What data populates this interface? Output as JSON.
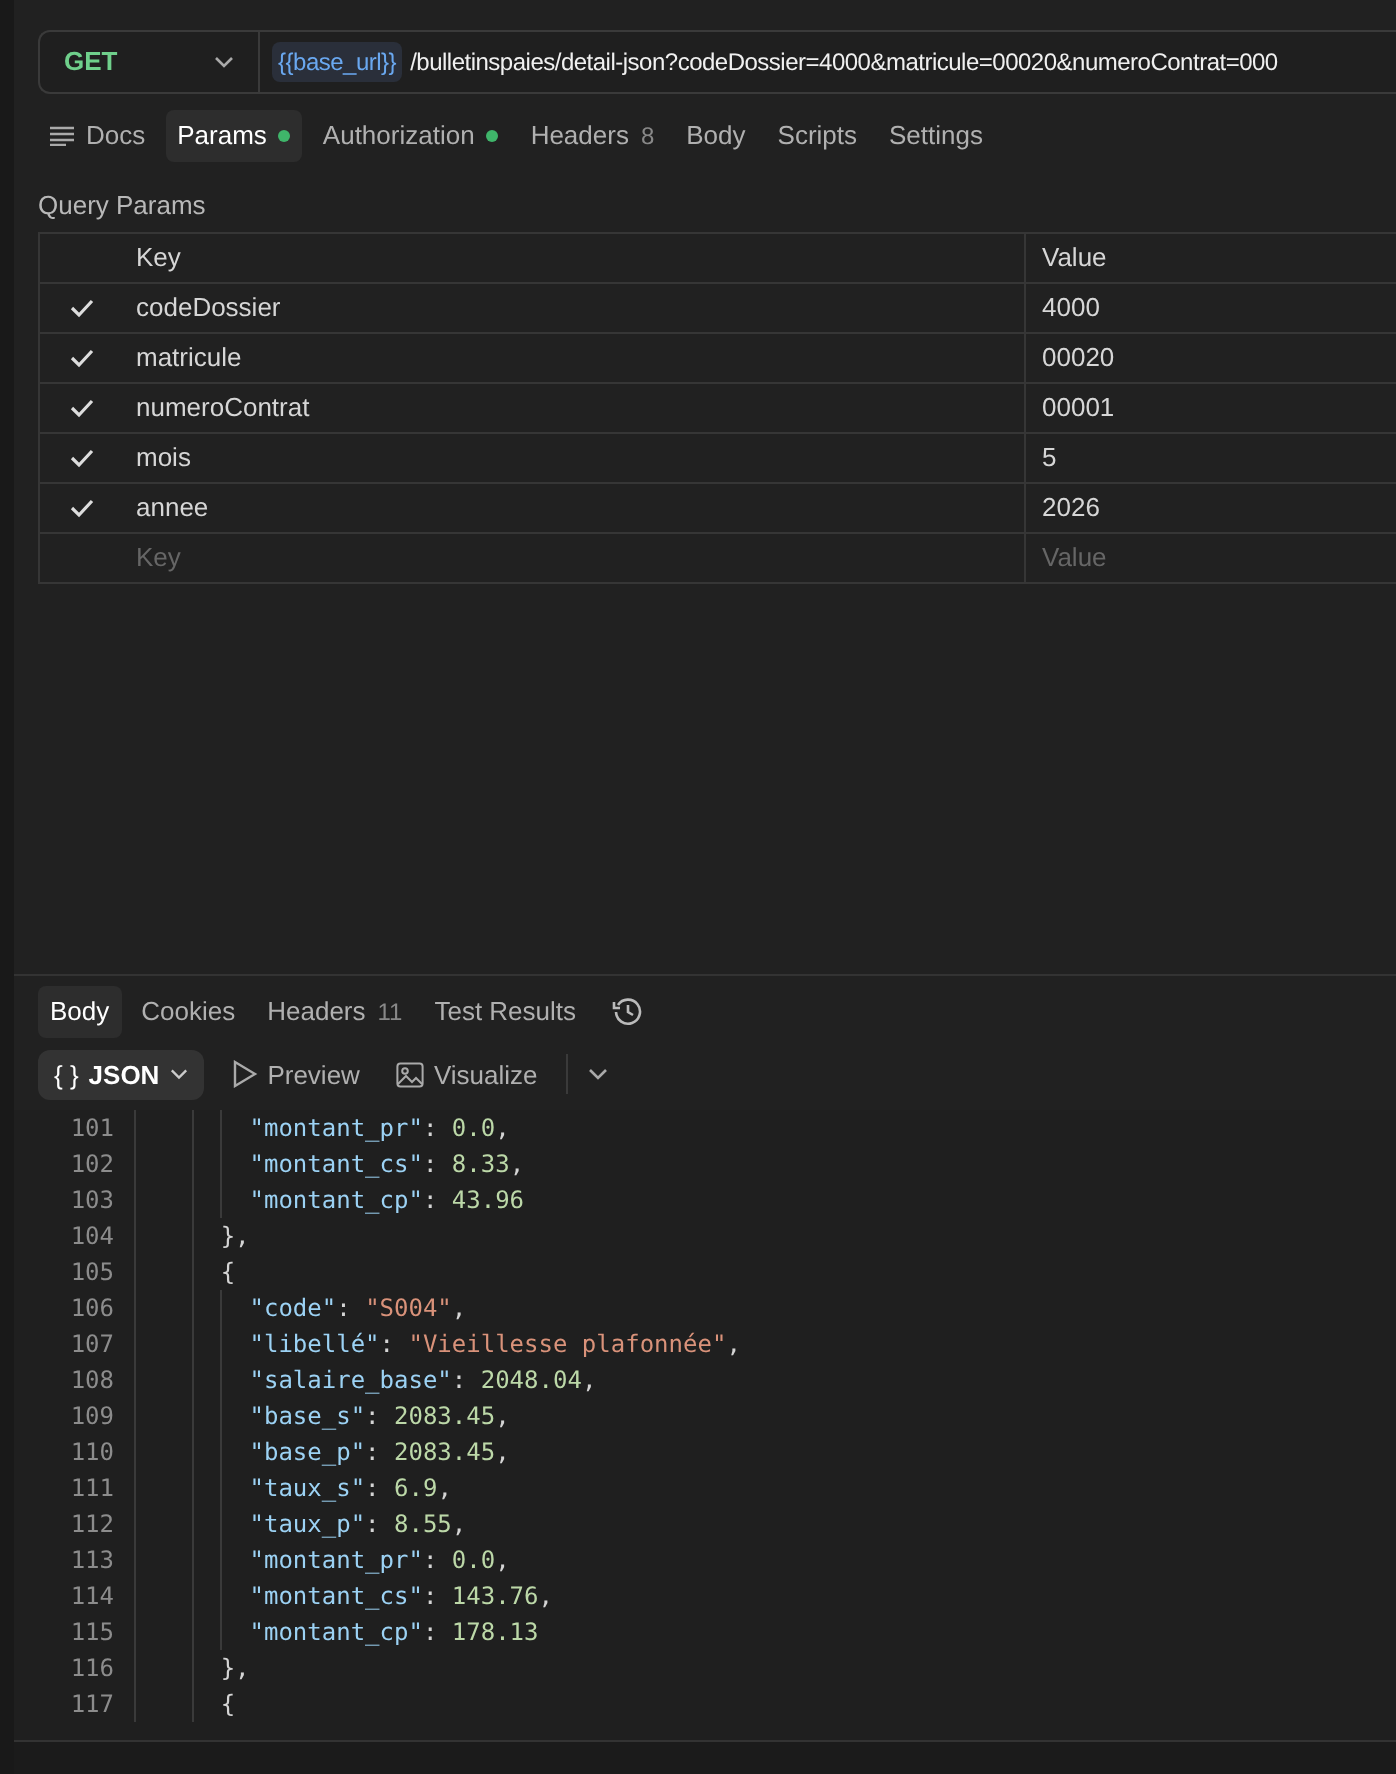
{
  "request": {
    "method": "GET",
    "url_variable": "{{base_url}}",
    "url_path": "/bulletinspaies/detail-json?codeDossier=4000&matricule=00020&numeroContrat=000"
  },
  "request_tabs": [
    {
      "label": "Docs",
      "kind": "docs",
      "selected": false
    },
    {
      "label": "Params",
      "kind": "dot",
      "selected": true
    },
    {
      "label": "Authorization",
      "kind": "dot",
      "selected": false
    },
    {
      "label": "Headers",
      "count": "8",
      "kind": "count",
      "selected": false
    },
    {
      "label": "Body",
      "kind": "plain",
      "selected": false
    },
    {
      "label": "Scripts",
      "kind": "plain",
      "selected": false
    },
    {
      "label": "Settings",
      "kind": "plain",
      "selected": false
    }
  ],
  "query_params": {
    "title": "Query Params",
    "columns": [
      "Key",
      "Value"
    ],
    "rows": [
      {
        "checked": true,
        "key": "codeDossier",
        "value": "4000"
      },
      {
        "checked": true,
        "key": "matricule",
        "value": "00020"
      },
      {
        "checked": true,
        "key": "numeroContrat",
        "value": "00001"
      },
      {
        "checked": true,
        "key": "mois",
        "value": "5"
      },
      {
        "checked": true,
        "key": "annee",
        "value": "2026"
      }
    ],
    "new_row": {
      "key_placeholder": "Key",
      "value_placeholder": "Value"
    }
  },
  "response_tabs": [
    {
      "label": "Body",
      "selected": true
    },
    {
      "label": "Cookies",
      "selected": false
    },
    {
      "label": "Headers",
      "count": "11",
      "selected": false
    },
    {
      "label": "Test Results",
      "selected": false
    }
  ],
  "response_toolbar": {
    "format_icon": "{ }",
    "format": "JSON",
    "buttons": [
      {
        "label": "Preview",
        "kind": "preview"
      },
      {
        "label": "Visualize",
        "kind": "visualize"
      }
    ]
  },
  "code_lines": [
    {
      "number": "101",
      "kind": "member",
      "tokens": [
        {
          "kind": "key",
          "text": "\"montant_pr\""
        },
        {
          "kind": "punct",
          "text": ": "
        },
        {
          "kind": "number",
          "text": "0.0"
        },
        {
          "kind": "punct",
          "text": ","
        }
      ]
    },
    {
      "number": "102",
      "kind": "member",
      "tokens": [
        {
          "kind": "key",
          "text": "\"montant_cs\""
        },
        {
          "kind": "punct",
          "text": ": "
        },
        {
          "kind": "number",
          "text": "8.33"
        },
        {
          "kind": "punct",
          "text": ","
        }
      ]
    },
    {
      "number": "103",
      "kind": "member",
      "tokens": [
        {
          "kind": "key",
          "text": "\"montant_cp\""
        },
        {
          "kind": "punct",
          "text": ": "
        },
        {
          "kind": "number",
          "text": "43.96"
        }
      ]
    },
    {
      "number": "104",
      "kind": "brace",
      "tokens": [
        {
          "kind": "punct",
          "text": "},"
        }
      ]
    },
    {
      "number": "105",
      "kind": "brace",
      "tokens": [
        {
          "kind": "punct",
          "text": "{"
        }
      ]
    },
    {
      "number": "106",
      "kind": "member",
      "tokens": [
        {
          "kind": "key",
          "text": "\"code\""
        },
        {
          "kind": "punct",
          "text": ": "
        },
        {
          "kind": "string",
          "text": "\"S004\""
        },
        {
          "kind": "punct",
          "text": ","
        }
      ]
    },
    {
      "number": "107",
      "kind": "member",
      "tokens": [
        {
          "kind": "key",
          "text": "\"libellé\""
        },
        {
          "kind": "punct",
          "text": ": "
        },
        {
          "kind": "string",
          "text": "\"Vieillesse plafonnée\""
        },
        {
          "kind": "punct",
          "text": ","
        }
      ]
    },
    {
      "number": "108",
      "kind": "member",
      "tokens": [
        {
          "kind": "key",
          "text": "\"salaire_base\""
        },
        {
          "kind": "punct",
          "text": ": "
        },
        {
          "kind": "number",
          "text": "2048.04"
        },
        {
          "kind": "punct",
          "text": ","
        }
      ]
    },
    {
      "number": "109",
      "kind": "member",
      "tokens": [
        {
          "kind": "key",
          "text": "\"base_s\""
        },
        {
          "kind": "punct",
          "text": ": "
        },
        {
          "kind": "number",
          "text": "2083.45"
        },
        {
          "kind": "punct",
          "text": ","
        }
      ]
    },
    {
      "number": "110",
      "kind": "member",
      "tokens": [
        {
          "kind": "key",
          "text": "\"base_p\""
        },
        {
          "kind": "punct",
          "text": ": "
        },
        {
          "kind": "number",
          "text": "2083.45"
        },
        {
          "kind": "punct",
          "text": ","
        }
      ]
    },
    {
      "number": "111",
      "kind": "member",
      "tokens": [
        {
          "kind": "key",
          "text": "\"taux_s\""
        },
        {
          "kind": "punct",
          "text": ": "
        },
        {
          "kind": "number",
          "text": "6.9"
        },
        {
          "kind": "punct",
          "text": ","
        }
      ]
    },
    {
      "number": "112",
      "kind": "member",
      "tokens": [
        {
          "kind": "key",
          "text": "\"taux_p\""
        },
        {
          "kind": "punct",
          "text": ": "
        },
        {
          "kind": "number",
          "text": "8.55"
        },
        {
          "kind": "punct",
          "text": ","
        }
      ]
    },
    {
      "number": "113",
      "kind": "member",
      "tokens": [
        {
          "kind": "key",
          "text": "\"montant_pr\""
        },
        {
          "kind": "punct",
          "text": ": "
        },
        {
          "kind": "number",
          "text": "0.0"
        },
        {
          "kind": "punct",
          "text": ","
        }
      ]
    },
    {
      "number": "114",
      "kind": "member",
      "tokens": [
        {
          "kind": "key",
          "text": "\"montant_cs\""
        },
        {
          "kind": "punct",
          "text": ": "
        },
        {
          "kind": "number",
          "text": "143.76"
        },
        {
          "kind": "punct",
          "text": ","
        }
      ]
    },
    {
      "number": "115",
      "kind": "member",
      "tokens": [
        {
          "kind": "key",
          "text": "\"montant_cp\""
        },
        {
          "kind": "punct",
          "text": ": "
        },
        {
          "kind": "number",
          "text": "178.13"
        }
      ]
    },
    {
      "number": "116",
      "kind": "brace",
      "tokens": [
        {
          "kind": "punct",
          "text": "},"
        }
      ]
    },
    {
      "number": "117",
      "kind": "brace",
      "tokens": [
        {
          "kind": "punct",
          "text": "{"
        }
      ]
    }
  ]
}
